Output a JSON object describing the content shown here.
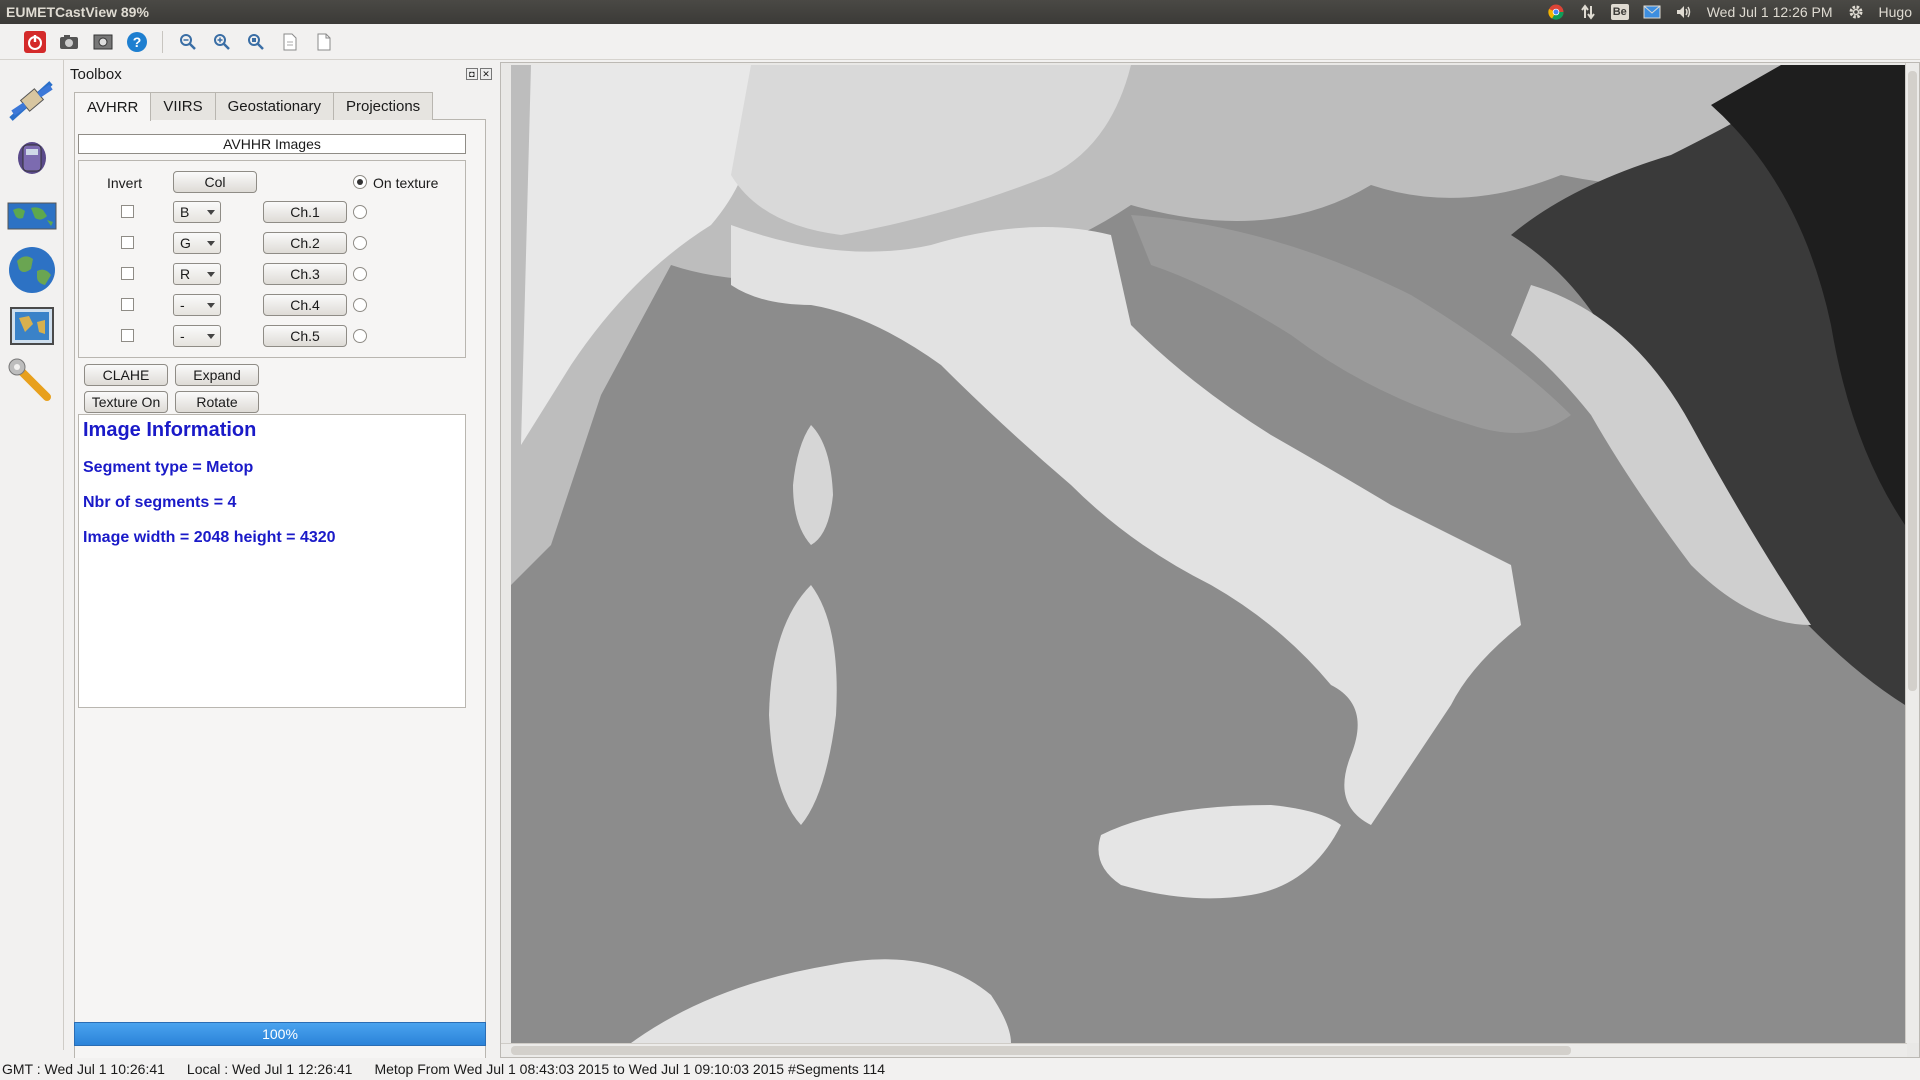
{
  "topbar": {
    "app_title": "EUMETCastView 89%",
    "clock": "Wed Jul  1 12:26 PM",
    "user": "Hugo",
    "tray_icons": [
      "chrome-icon",
      "network-updown-icon",
      "behance-icon",
      "mail-icon",
      "volume-icon",
      "gear-icon"
    ],
    "be_label": "Be"
  },
  "toolbar": {
    "buttons": [
      "power-icon",
      "camera-icon",
      "screenshot-icon",
      "help-icon",
      "zoom-out-icon",
      "zoom-in-icon",
      "zoom-fit-icon",
      "save-icon",
      "export-icon"
    ],
    "help_label": "?"
  },
  "sidebar": {
    "items": [
      "satellite-icon",
      "geostationary-satellite-icon",
      "world-map-icon",
      "globe-icon",
      "image-map-icon",
      "tools-icon"
    ]
  },
  "toolbox": {
    "title": "Toolbox",
    "float_label": "◘",
    "close_label": "✕",
    "tabs": [
      {
        "label": "AVHRR",
        "active": true
      },
      {
        "label": "VIIRS",
        "active": false
      },
      {
        "label": "Geostationary",
        "active": false
      },
      {
        "label": "Projections",
        "active": false
      }
    ],
    "section_title": "AVHHR Images",
    "invert_label": "Invert",
    "col_label": "Col",
    "on_texture_label": "On texture",
    "channels": [
      {
        "combo": "B",
        "button": "Ch.1",
        "inverted": false
      },
      {
        "combo": "G",
        "button": "Ch.2",
        "inverted": false
      },
      {
        "combo": "R",
        "button": "Ch.3",
        "inverted": false
      },
      {
        "combo": "-",
        "button": "Ch.4",
        "inverted": false
      },
      {
        "combo": "-",
        "button": "Ch.5",
        "inverted": false
      }
    ],
    "clahe_label": "CLAHE",
    "expand_label": "Expand",
    "texture_on_label": "Texture On",
    "rotate_label": "Rotate",
    "info": {
      "title": "Image Information",
      "lines": [
        "Segment type = Metop",
        "Nbr of segments = 4",
        "Image width = 2048 height = 4320"
      ]
    },
    "progress_label": "100%",
    "progress_value": 1.0
  },
  "statusbar": {
    "gmt": "GMT : Wed Jul  1 10:26:41",
    "local": "Local : Wed Jul  1 12:26:41",
    "info": "Metop From Wed Jul 1 08:43:03 2015 to Wed Jul 1 09:10:03 2015  #Segments 114"
  },
  "colors": {
    "info_text": "#1a1ac8",
    "progress": "#2b83d9",
    "topbar": "#3b3a37"
  }
}
